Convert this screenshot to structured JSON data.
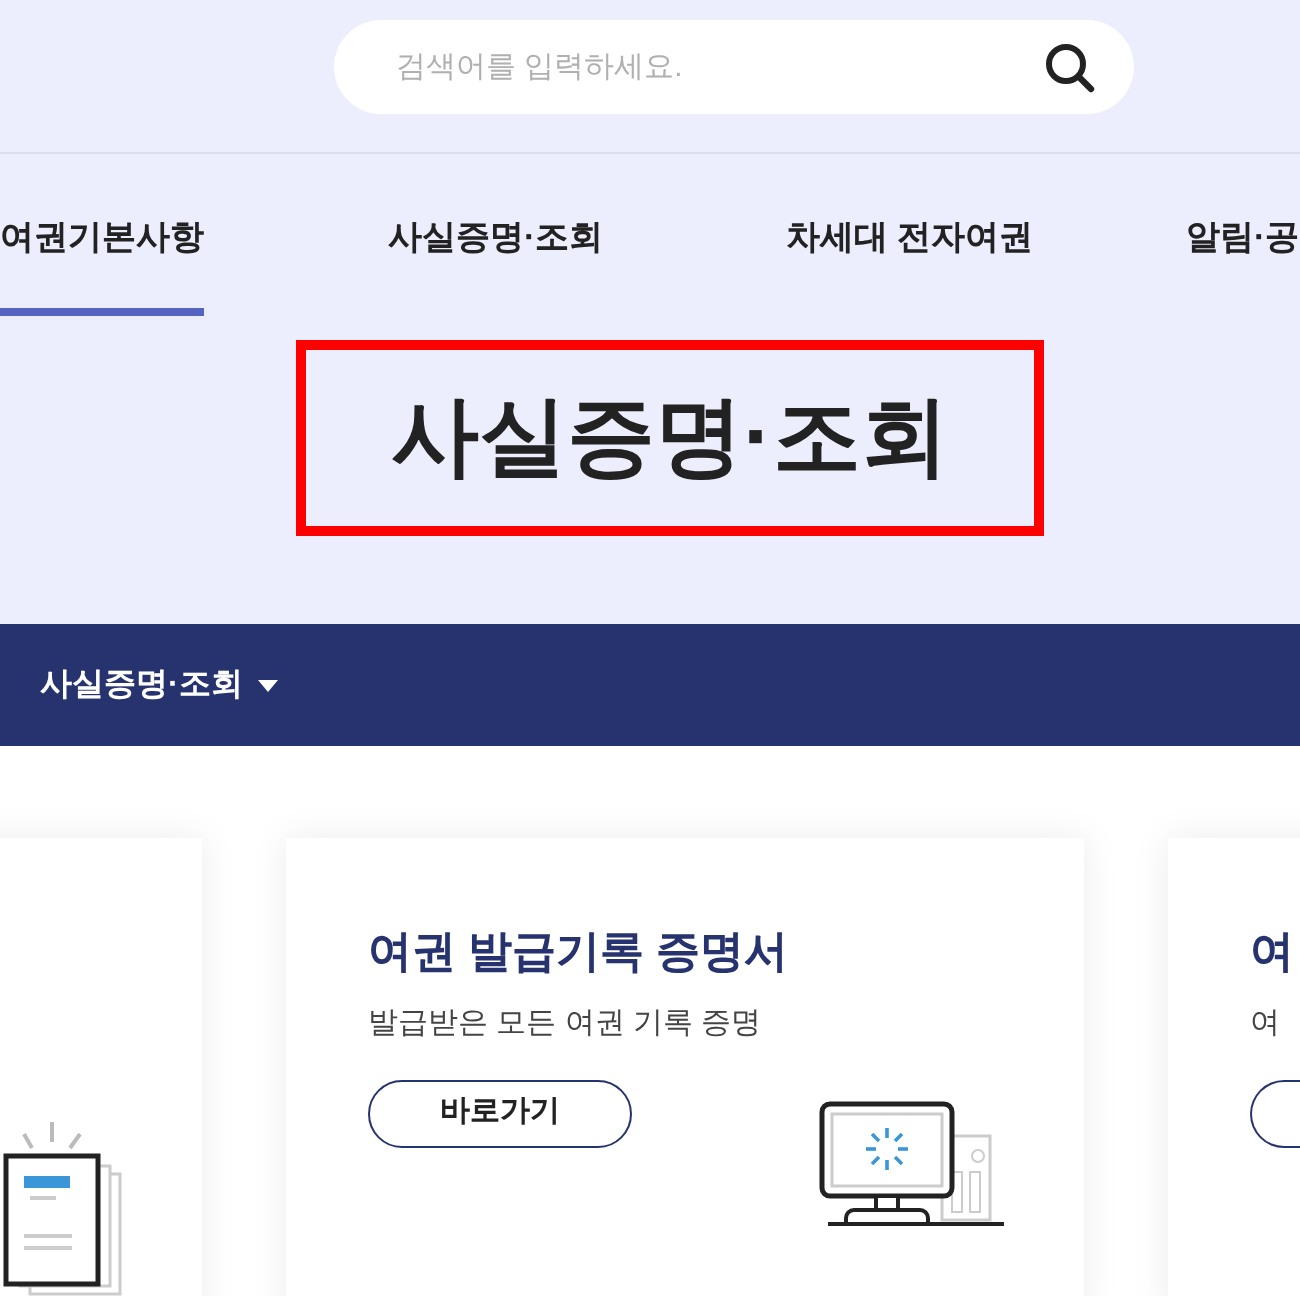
{
  "search": {
    "placeholder": "검색어를 입력하세요."
  },
  "nav_tabs": [
    {
      "label": "여권기본사항",
      "selected": true
    },
    {
      "label": "사실증명·조회",
      "selected": false
    },
    {
      "label": "차세대 전자여권",
      "selected": false
    },
    {
      "label": "알림·공",
      "selected": false
    }
  ],
  "page_title": "사실증명·조회",
  "section_menu": {
    "label": "사실증명·조회"
  },
  "cards": [
    {
      "kind": "document"
    },
    {
      "kind": "computer",
      "title": "여권 발급기록 증명서",
      "description": "발급받은 모든 여권 기록 증명",
      "button": "바로가기"
    },
    {
      "kind": "partial",
      "title": "여",
      "description": "여"
    }
  ]
}
